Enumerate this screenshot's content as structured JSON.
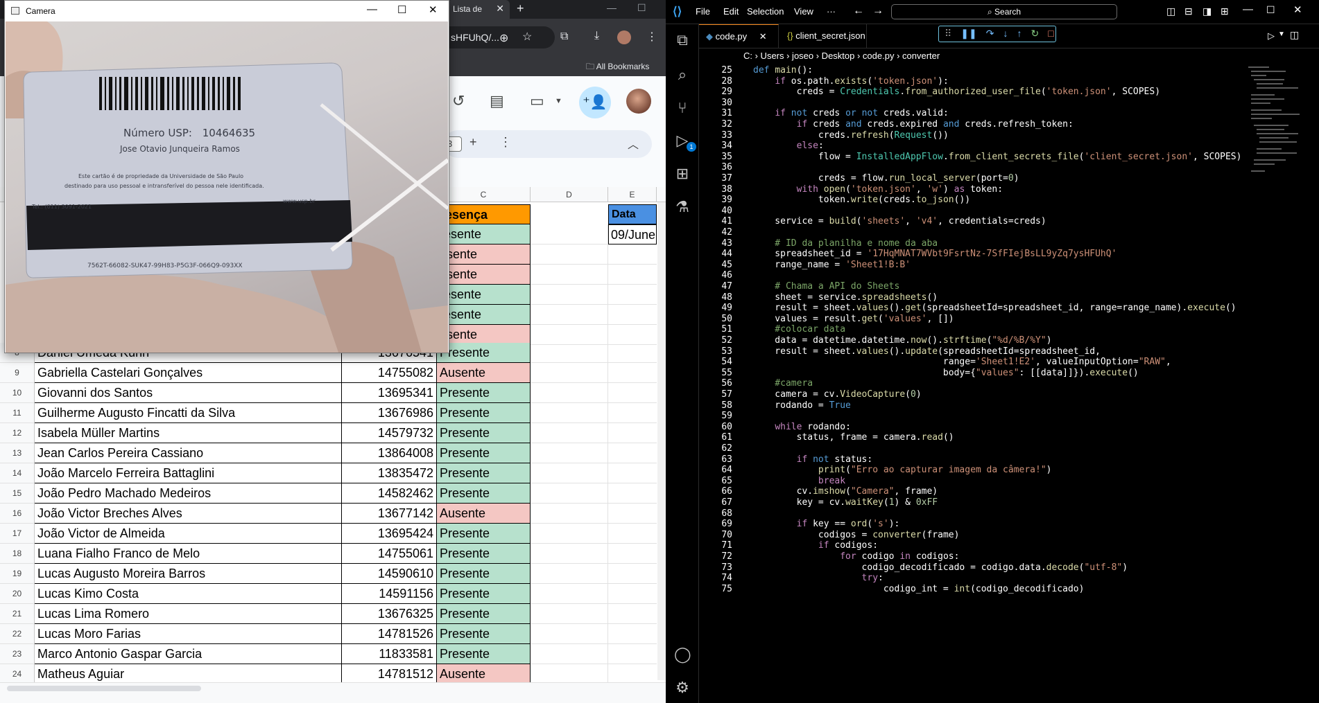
{
  "browser": {
    "tab_title": "Lista de",
    "omnibox_text": "sHFUhQ/...",
    "bookmarks_label": "All Bookmarks",
    "cell_ref_fragment": "3",
    "columns": [
      "C",
      "D",
      "E"
    ],
    "header_presenca": "resença",
    "header_data": "Data",
    "date_value": "09/June",
    "rows": [
      {
        "n": "8",
        "name": "Daniel Umeda Kuhn",
        "num": "13676541",
        "status": "Presente",
        "cls": "presente"
      },
      {
        "n": "9",
        "name": "Gabriella Castelari Gonçalves",
        "num": "14755082",
        "status": "Ausente",
        "cls": "ausente"
      },
      {
        "n": "10",
        "name": "Giovanni dos Santos",
        "num": "13695341",
        "status": "Presente",
        "cls": "presente"
      },
      {
        "n": "11",
        "name": "Guilherme Augusto Fincatti da Silva",
        "num": "13676986",
        "status": "Presente",
        "cls": "presente"
      },
      {
        "n": "12",
        "name": "Isabela Müller Martins",
        "num": "14579732",
        "status": "Presente",
        "cls": "presente"
      },
      {
        "n": "13",
        "name": "Jean Carlos Pereira Cassiano",
        "num": "13864008",
        "status": "Presente",
        "cls": "presente"
      },
      {
        "n": "14",
        "name": "João Marcelo Ferreira Battaglini",
        "num": "13835472",
        "status": "Presente",
        "cls": "presente"
      },
      {
        "n": "15",
        "name": "João Pedro Machado Medeiros",
        "num": "14582462",
        "status": "Presente",
        "cls": "presente"
      },
      {
        "n": "16",
        "name": "João Victor Breches Alves",
        "num": "13677142",
        "status": "Ausente",
        "cls": "ausente"
      },
      {
        "n": "17",
        "name": "João Victor de Almeida",
        "num": "13695424",
        "status": "Presente",
        "cls": "presente"
      },
      {
        "n": "18",
        "name": "Luana Fialho Franco de Melo",
        "num": "14755061",
        "status": "Presente",
        "cls": "presente"
      },
      {
        "n": "19",
        "name": "Lucas Augusto Moreira Barros",
        "num": "14590610",
        "status": "Presente",
        "cls": "presente"
      },
      {
        "n": "20",
        "name": "Lucas Kimo Costa",
        "num": "14591156",
        "status": "Presente",
        "cls": "presente"
      },
      {
        "n": "21",
        "name": "Lucas Lima Romero",
        "num": "13676325",
        "status": "Presente",
        "cls": "presente"
      },
      {
        "n": "22",
        "name": "Lucas Moro Farias",
        "num": "14781526",
        "status": "Presente",
        "cls": "presente"
      },
      {
        "n": "23",
        "name": "Marco Antonio Gaspar Garcia",
        "num": "11833581",
        "status": "Presente",
        "cls": "presente"
      },
      {
        "n": "24",
        "name": "Matheus Aguiar",
        "num": "14781512",
        "status": "Ausente",
        "cls": "ausente"
      }
    ],
    "hidden_rows": [
      {
        "status": "resente",
        "cls": "presente"
      },
      {
        "status": "usente",
        "cls": "ausente"
      },
      {
        "status": "usente",
        "cls": "ausente"
      },
      {
        "status": "resente",
        "cls": "presente"
      },
      {
        "status": "resente",
        "cls": "presente"
      },
      {
        "status": "usente",
        "cls": "ausente"
      }
    ]
  },
  "camera": {
    "title": "Camera",
    "card_number_label": "Número USP:",
    "card_number": "10464635",
    "card_name": "Jose Otavio Junqueira Ramos",
    "card_text_1": "Este cartão é de propriedade da Universidade de São Paulo",
    "card_text_2": "destinado para uso pessoal e intransferível do pessoa nele identificada.",
    "card_tel": "Tel.: (011) 3091-2021",
    "card_site": "www.usp.br",
    "card_code": "7562T-66082-SUK47-99H83-P5G3F-066Q9-093XX"
  },
  "vscode": {
    "menu": [
      "File",
      "Edit",
      "Selection",
      "View",
      "···"
    ],
    "search_label": "Search",
    "tabs": [
      "code.py",
      "client_secret.json"
    ],
    "breadcrumb": "C: › Users › joseo › Desktop › code.py › converter",
    "sticky_line": "def main():",
    "badge": "1"
  },
  "code_lines": [
    {
      "n": "25",
      "t": "def main():"
    },
    {
      "n": "28",
      "t": "    if os.path.exists('token.json'):"
    },
    {
      "n": "29",
      "t": "        creds = Credentials.from_authorized_user_file('token.json', SCOPES)"
    },
    {
      "n": "30",
      "t": ""
    },
    {
      "n": "31",
      "t": "    if not creds or not creds.valid:"
    },
    {
      "n": "32",
      "t": "        if creds and creds.expired and creds.refresh_token:"
    },
    {
      "n": "33",
      "t": "            creds.refresh(Request())"
    },
    {
      "n": "34",
      "t": "        else:"
    },
    {
      "n": "35",
      "t": "            flow = InstalledAppFlow.from_client_secrets_file('client_secret.json', SCOPES)"
    },
    {
      "n": "36",
      "t": ""
    },
    {
      "n": "37",
      "t": "            creds = flow.run_local_server(port=0)"
    },
    {
      "n": "38",
      "t": "        with open('token.json', 'w') as token:"
    },
    {
      "n": "39",
      "t": "            token.write(creds.to_json())"
    },
    {
      "n": "40",
      "t": ""
    },
    {
      "n": "41",
      "t": "    service = build('sheets', 'v4', credentials=creds)"
    },
    {
      "n": "42",
      "t": ""
    },
    {
      "n": "43",
      "t": "    # ID da planilha e nome da aba"
    },
    {
      "n": "44",
      "t": "    spreadsheet_id = '17HqMNAT7WVbt9FsrtNz-7SfFIejBsLL9yZq7ysHFUhQ'"
    },
    {
      "n": "45",
      "t": "    range_name = 'Sheet1!B:B'"
    },
    {
      "n": "46",
      "t": ""
    },
    {
      "n": "47",
      "t": "    # Chama a API do Sheets"
    },
    {
      "n": "48",
      "t": "    sheet = service.spreadsheets()"
    },
    {
      "n": "49",
      "t": "    result = sheet.values().get(spreadsheetId=spreadsheet_id, range=range_name).execute()"
    },
    {
      "n": "50",
      "t": "    values = result.get('values', [])"
    },
    {
      "n": "51",
      "t": "    #colocar data"
    },
    {
      "n": "52",
      "t": "    data = datetime.datetime.now().strftime(\"%d/%B/%Y\")"
    },
    {
      "n": "53",
      "t": "    result = sheet.values().update(spreadsheetId=spreadsheet_id,"
    },
    {
      "n": "54",
      "t": "                                   range='Sheet1!E2', valueInputOption=\"RAW\","
    },
    {
      "n": "55",
      "t": "                                   body={\"values\": [[data]]}).execute()"
    },
    {
      "n": "56",
      "t": "    #camera"
    },
    {
      "n": "57",
      "t": "    camera = cv.VideoCapture(0)"
    },
    {
      "n": "58",
      "t": "    rodando = True"
    },
    {
      "n": "59",
      "t": ""
    },
    {
      "n": "60",
      "t": "    while rodando:"
    },
    {
      "n": "61",
      "t": "        status, frame = camera.read()"
    },
    {
      "n": "62",
      "t": ""
    },
    {
      "n": "63",
      "t": "        if not status:"
    },
    {
      "n": "64",
      "t": "            print(\"Erro ao capturar imagem da câmera!\")"
    },
    {
      "n": "65",
      "t": "            break"
    },
    {
      "n": "66",
      "t": "        cv.imshow(\"Camera\", frame)"
    },
    {
      "n": "67",
      "t": "        key = cv.waitKey(1) & 0xFF"
    },
    {
      "n": "68",
      "t": ""
    },
    {
      "n": "69",
      "t": "        if key == ord('s'):"
    },
    {
      "n": "70",
      "t": "            codigos = converter(frame)"
    },
    {
      "n": "71",
      "t": "            if codigos:"
    },
    {
      "n": "72",
      "t": "                for codigo in codigos:"
    },
    {
      "n": "73",
      "t": "                    codigo_decodificado = codigo.data.decode(\"utf-8\")"
    },
    {
      "n": "74",
      "t": "                    try:"
    },
    {
      "n": "75",
      "t": "                        codigo_int = int(codigo_decodificado)"
    }
  ]
}
